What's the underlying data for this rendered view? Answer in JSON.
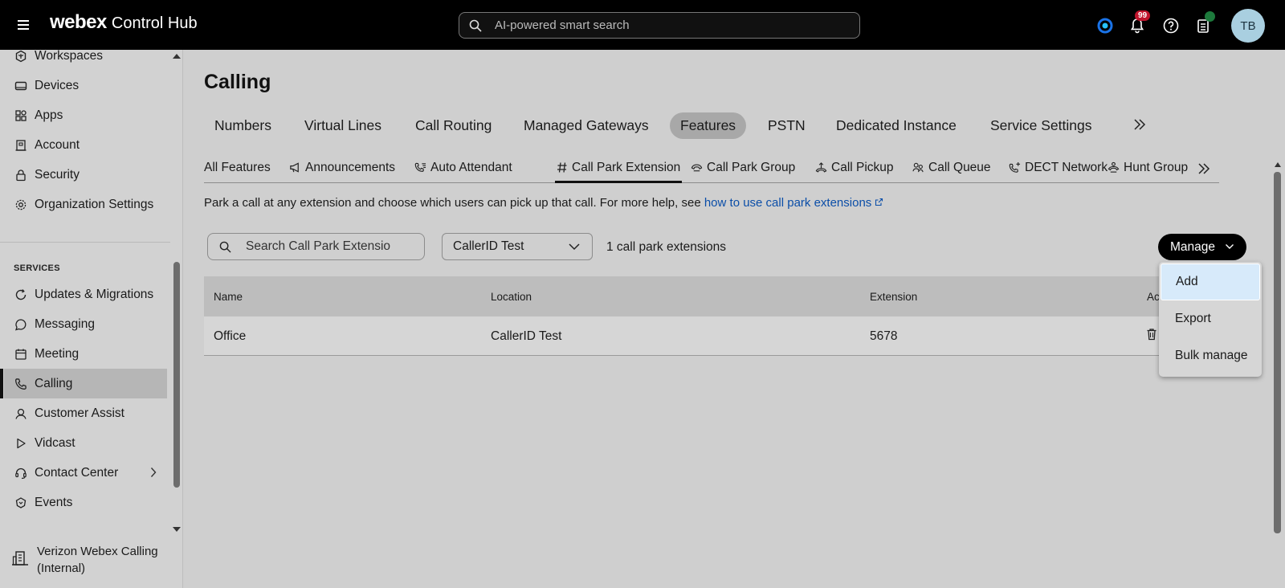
{
  "header": {
    "brand_bold": "webex",
    "brand_rest": "Control Hub",
    "search_placeholder": "AI-powered smart search",
    "notification_count": "99",
    "avatar_initials": "TB"
  },
  "sidebar": {
    "items_top": [
      {
        "label": "Workspaces",
        "icon": "workspaces-icon"
      },
      {
        "label": "Devices",
        "icon": "devices-icon"
      },
      {
        "label": "Apps",
        "icon": "apps-icon"
      },
      {
        "label": "Account",
        "icon": "account-icon"
      },
      {
        "label": "Security",
        "icon": "lock-icon"
      },
      {
        "label": "Organization Settings",
        "icon": "gear-icon"
      }
    ],
    "services_label": "SERVICES",
    "items_services": [
      {
        "label": "Updates & Migrations",
        "icon": "refresh-icon"
      },
      {
        "label": "Messaging",
        "icon": "chat-icon"
      },
      {
        "label": "Meeting",
        "icon": "calendar-icon"
      },
      {
        "label": "Calling",
        "icon": "phone-icon"
      },
      {
        "label": "Customer Assist",
        "icon": "customer-assist-icon"
      },
      {
        "label": "Vidcast",
        "icon": "play-icon"
      },
      {
        "label": "Contact Center",
        "icon": "headset-icon"
      },
      {
        "label": "Events",
        "icon": "events-icon"
      }
    ],
    "org_name": "Verizon Webex Calling (Internal)"
  },
  "main": {
    "title": "Calling",
    "tabs": [
      "Numbers",
      "Virtual Lines",
      "Call Routing",
      "Managed Gateways",
      "Features",
      "PSTN",
      "Dedicated Instance",
      "Service Settings"
    ],
    "active_tab": "Features",
    "subtabs": [
      "All Features",
      "Announcements",
      "Auto Attendant",
      "Call Park Extension",
      "Call Park Group",
      "Call Pickup",
      "Call Queue",
      "DECT Network",
      "Hunt Group"
    ],
    "active_subtab": "Call Park Extension",
    "description": "Park a call at any extension and choose which users can pick up that call. For more help, see ",
    "help_link": "how to use call park extensions",
    "search_placeholder": "Search Call Park Extensions",
    "location_selected": "CallerID Test",
    "count_text": "1 call park extensions",
    "manage_label": "Manage",
    "manage_menu": [
      "Add",
      "Export",
      "Bulk manage"
    ],
    "table": {
      "columns": [
        "Name",
        "Location",
        "Extension",
        "Ac"
      ],
      "rows": [
        {
          "name": "Office",
          "location": "CallerID Test",
          "extension": "5678"
        }
      ]
    }
  }
}
